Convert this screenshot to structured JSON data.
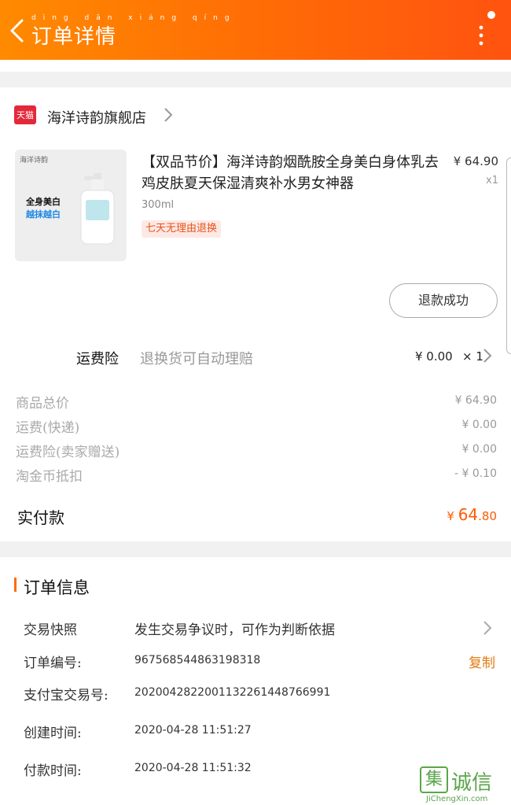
{
  "header": {
    "title": "订单详情",
    "pinyin": "dìng dān xiáng qíng"
  },
  "shop": {
    "badge": "天猫",
    "name": "海洋诗韵旗舰店"
  },
  "product": {
    "image_brand": "海洋诗韵",
    "image_line1": "全身美白",
    "image_line2": "越抹越白",
    "title": "【双品节价】海洋诗韵烟酰胺全身美白身体乳去鸡皮肤夏天保湿清爽补水男女神器",
    "price": "¥ 64.90",
    "qty": "x1",
    "spec": "300ml",
    "tag": "七天无理由退换"
  },
  "refund_button": "退款成功",
  "insurance": {
    "label": "运费险",
    "desc": "退换货可自动理赔",
    "price": "¥ 0.00",
    "qty": "× 1"
  },
  "costs": [
    {
      "label": "商品总价",
      "value": "¥ 64.90"
    },
    {
      "label": "运费(快递)",
      "value": "¥ 0.00"
    },
    {
      "label": "运费险(卖家赠送)",
      "value": "¥ 0.00"
    },
    {
      "label": "淘金币抵扣",
      "value": "- ¥ 0.10"
    }
  ],
  "paid": {
    "label": "实付款",
    "currency": "¥ ",
    "int": "64",
    "dec": ".80"
  },
  "order_info": {
    "title": "订单信息",
    "snapshot_label": "交易快照",
    "snapshot_value": "发生交易争议时，可作为判断依据",
    "order_no_label": "订单编号:",
    "order_no": "967568544863198318",
    "copy": "复制",
    "alipay_label": "支付宝交易号:",
    "alipay_no": "2020042822001132261448766991",
    "created_label": "创建时间:",
    "created": "2020-04-28  11:51:27",
    "paid_label": "付款时间:",
    "paid_time": "2020-04-28  11:51:32"
  },
  "watermark": {
    "box": "集",
    "chars": "诚信",
    "url": "JiChengXin.com"
  },
  "colors": {
    "header_start": "#ff8a00",
    "header_end": "#ff5310",
    "accent": "#ff5a00",
    "tag_bg": "#fde9e4"
  }
}
